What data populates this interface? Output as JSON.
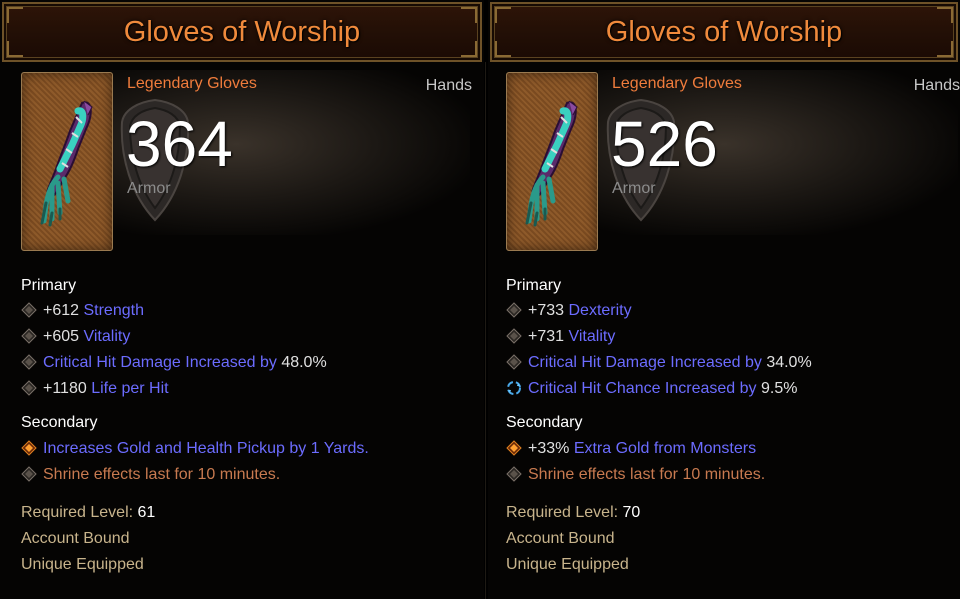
{
  "tooltips": [
    {
      "title": "Gloves of Worship",
      "item_type": "Legendary Gloves",
      "slot": "Hands",
      "armor_value": "364",
      "armor_label": "Armor",
      "primary_label": "Primary",
      "primary": [
        {
          "value": "+612 ",
          "stat": "Strength",
          "icon": "diamond-bullet-icon"
        },
        {
          "value": "+605 ",
          "stat": "Vitality",
          "icon": "diamond-bullet-icon"
        },
        {
          "stat": "Critical Hit Damage Increased by ",
          "value": "48.0%",
          "icon": "diamond-bullet-icon"
        },
        {
          "value": "+1180 ",
          "stat": "Life per Hit",
          "icon": "diamond-bullet-icon"
        }
      ],
      "secondary_label": "Secondary",
      "secondary": [
        {
          "text": "Increases Gold and Health Pickup by 1 Yards.",
          "icon": "orange-diamond-bullet-icon"
        },
        {
          "text": "Shrine effects last for 10 minutes.",
          "icon": "diamond-bullet-icon"
        }
      ],
      "required_level_label": "Required Level: ",
      "required_level": "61",
      "account_bound": "Account Bound",
      "unique_equipped": "Unique Equipped"
    },
    {
      "title": "Gloves of Worship",
      "item_type": "Legendary Gloves",
      "slot": "Hands",
      "armor_value": "526",
      "armor_label": "Armor",
      "primary_label": "Primary",
      "primary": [
        {
          "value": "+733 ",
          "stat": "Dexterity",
          "icon": "diamond-bullet-icon"
        },
        {
          "value": "+731 ",
          "stat": "Vitality",
          "icon": "diamond-bullet-icon"
        },
        {
          "stat": "Critical Hit Damage Increased by ",
          "value": "34.0%",
          "icon": "diamond-bullet-icon"
        },
        {
          "stat": "Critical Hit Chance Increased by ",
          "value": "9.5%",
          "icon": "enchant-swirl-icon"
        }
      ],
      "secondary_label": "Secondary",
      "secondary": [
        {
          "value": "+33% ",
          "stat": "Extra Gold from Monsters",
          "icon": "orange-diamond-bullet-icon"
        },
        {
          "text": "Shrine effects last for 10 minutes.",
          "icon": "diamond-bullet-icon"
        }
      ],
      "required_level_label": "Required Level: ",
      "required_level": "70",
      "account_bound": "Account Bound",
      "unique_equipped": "Unique Equipped"
    }
  ],
  "colors": {
    "title": "#f08a3c",
    "legendary": "#f07c3c",
    "affix_blue": "#6c6cff",
    "shrine_orange": "#c87a50",
    "footer_gold": "#c8b48c"
  }
}
